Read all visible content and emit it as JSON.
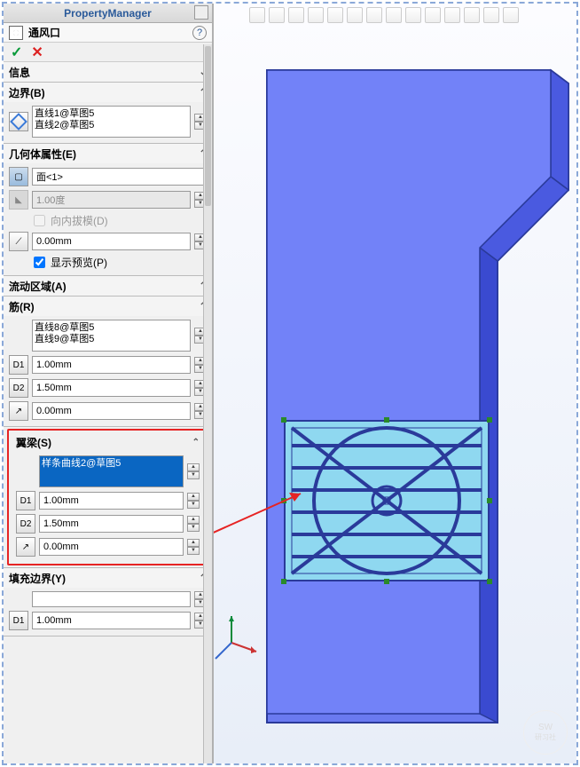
{
  "pm": {
    "header": "PropertyManager",
    "title": "通风口",
    "help": "?"
  },
  "sections": {
    "info": {
      "title": "信息"
    },
    "boundary": {
      "title": "边界(B)",
      "items": [
        "直线1@草图5",
        "直线2@草图5"
      ]
    },
    "geom": {
      "title": "几何体属性(E)",
      "face": "面<1>",
      "angle": "1.00度",
      "draft_label": "向内拔模(D)",
      "offset": "0.00mm",
      "preview_label": "显示预览(P)"
    },
    "flow": {
      "title": "流动区域(A)"
    },
    "ribs": {
      "title": "筋(R)",
      "items": [
        "直线8@草图5",
        "直线9@草图5"
      ],
      "d1": "1.00mm",
      "d2": "1.50mm",
      "d3": "0.00mm"
    },
    "spars": {
      "title": "翼梁(S)",
      "selected": "样条曲线2@草图5",
      "d1": "1.00mm",
      "d2": "1.50mm",
      "d3": "0.00mm"
    },
    "fill": {
      "title": "填充边界(Y)",
      "d1": "1.00mm"
    }
  },
  "icons": {
    "d1": "D1",
    "d2": "D2",
    "arrow": "↗"
  },
  "watermark": {
    "l1": "SW",
    "l2": "研习社"
  }
}
